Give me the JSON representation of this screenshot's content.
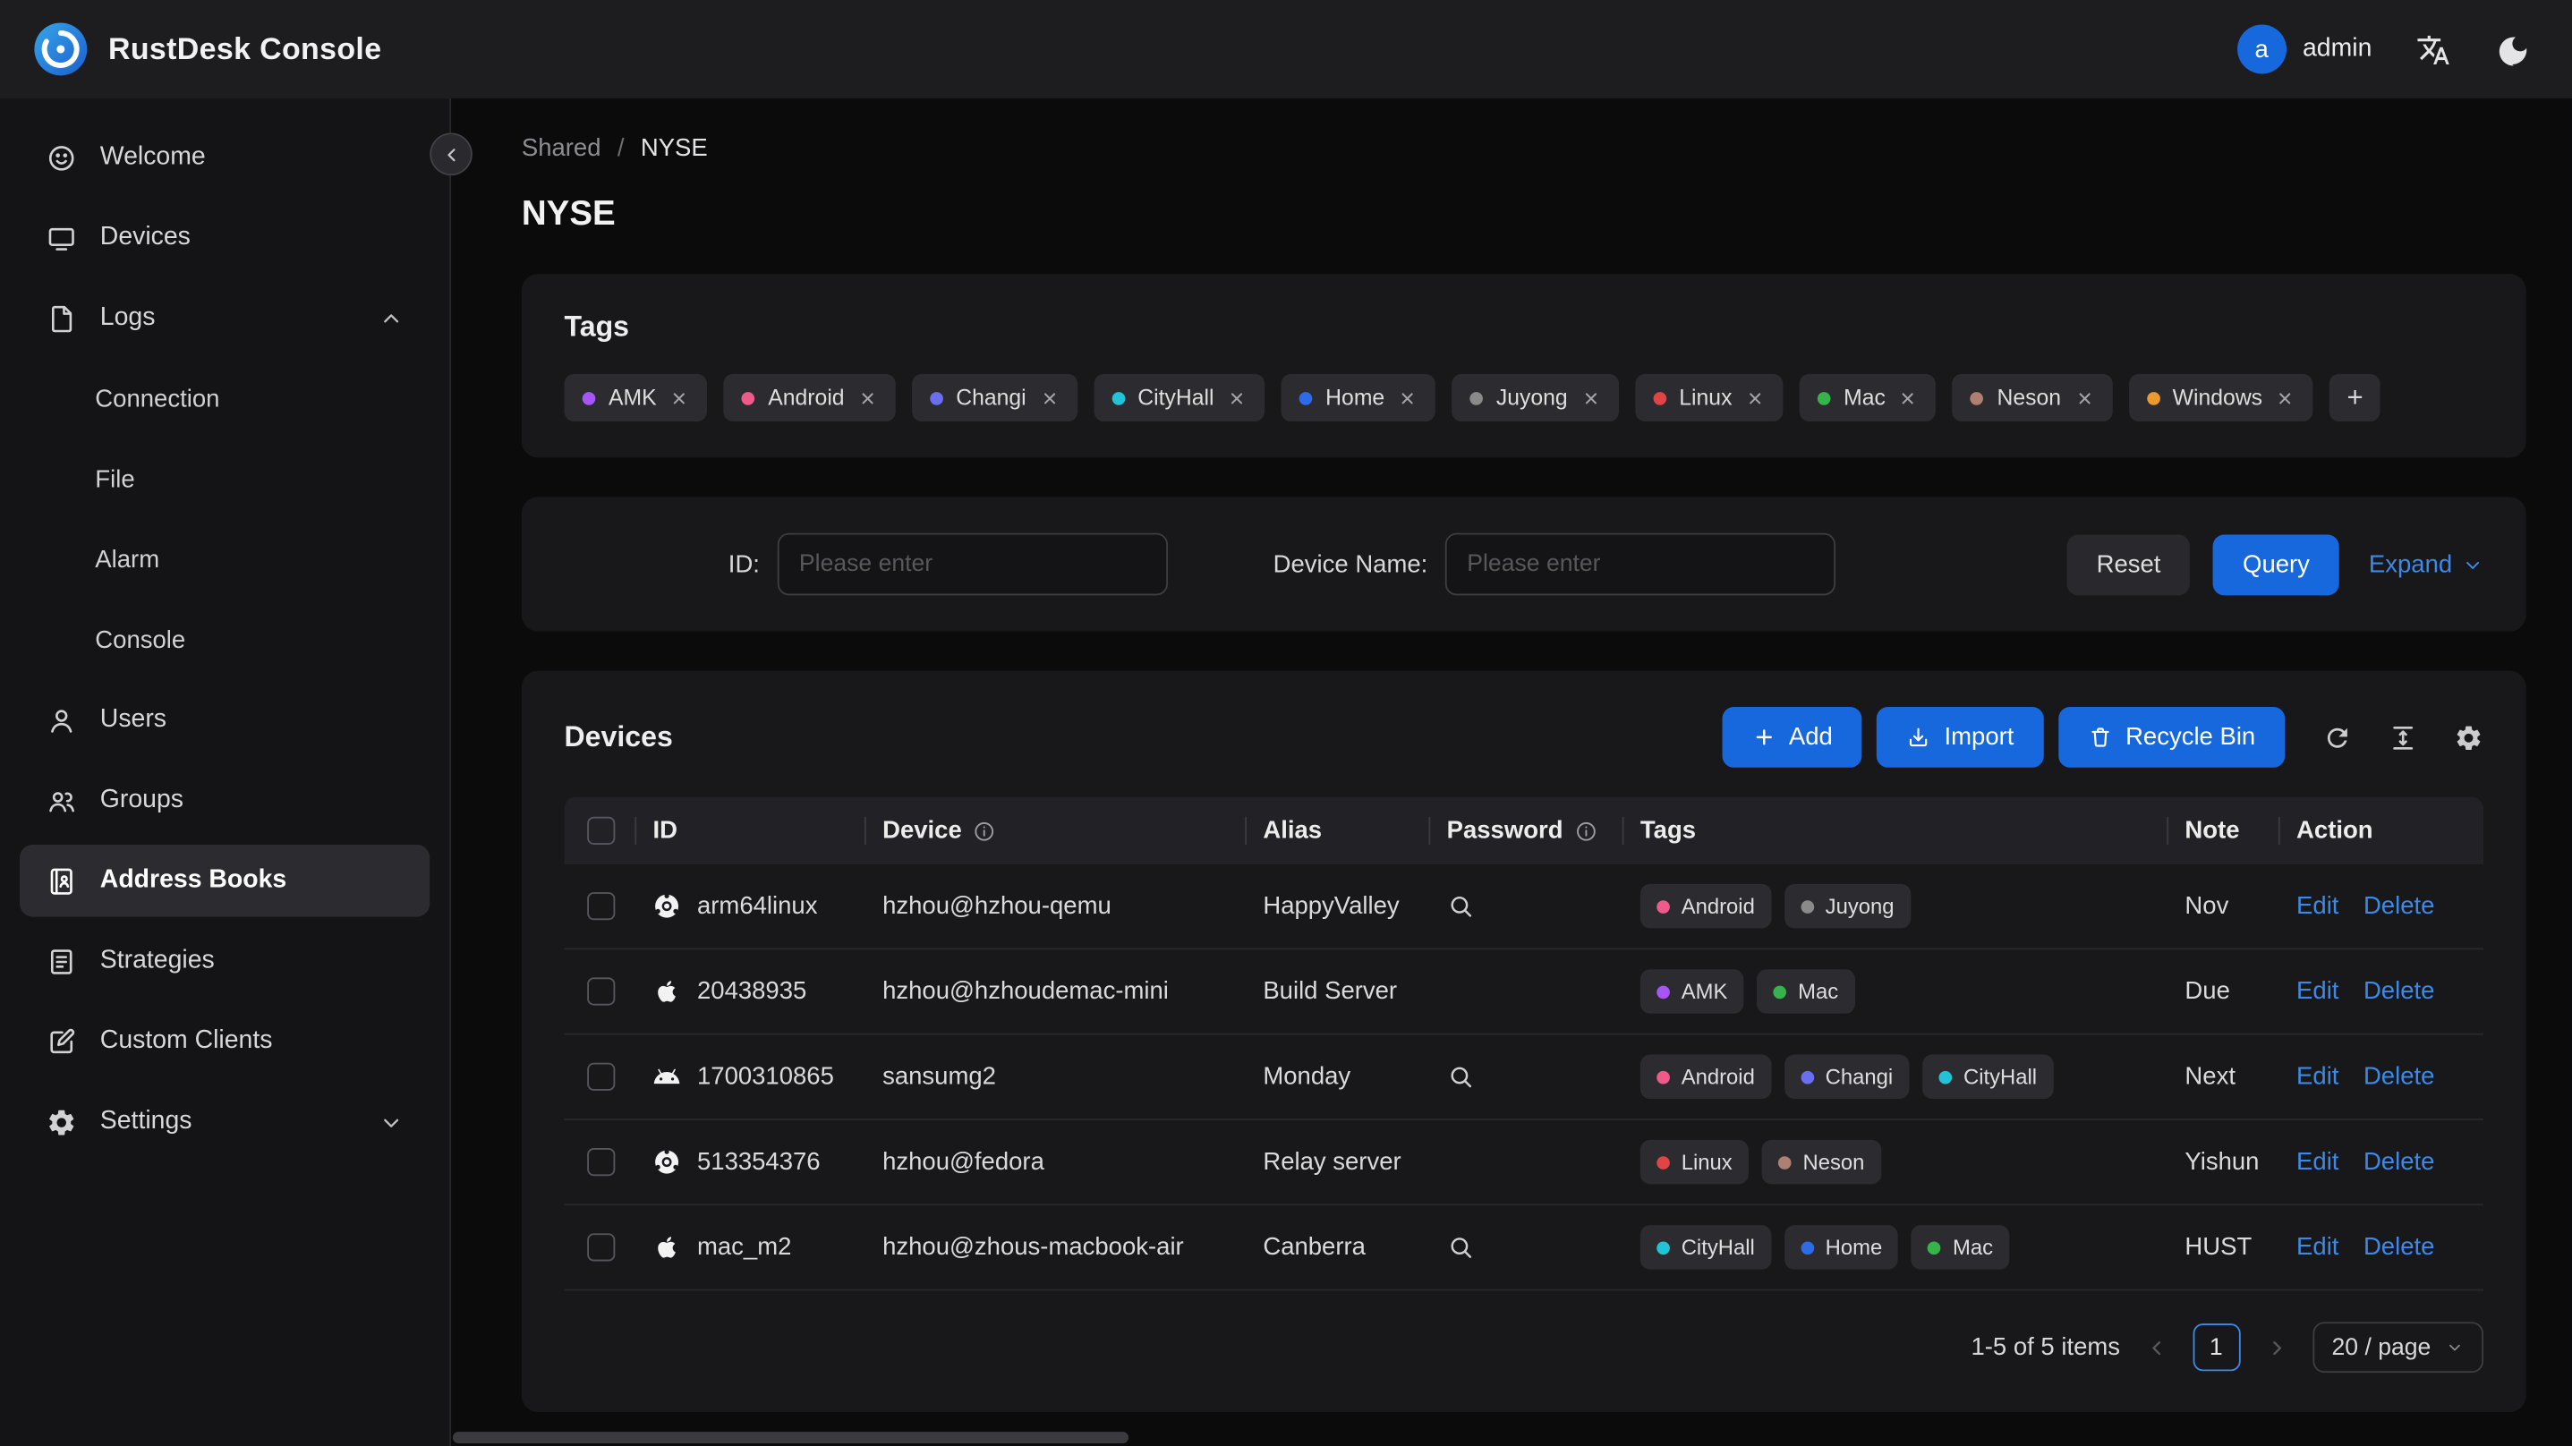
{
  "colors": {
    "accent": "#1668dc",
    "link": "#3c89e8",
    "avatar_bg": "#1668dc",
    "tag_colors": {
      "AMK": "#a855f7",
      "Android": "#ee5b8a",
      "Changi": "#6a6ff0",
      "CityHall": "#22c3d6",
      "Home": "#2e6be6",
      "Juyong": "#8a8a8a",
      "Linux": "#e04444",
      "Mac": "#36b34a",
      "Neson": "#ad8071",
      "Windows": "#eb9a2d"
    }
  },
  "header": {
    "app_title": "RustDesk Console",
    "user_initial": "a",
    "user_name": "admin"
  },
  "icon_glyphs": {
    "translate-icon": "language/translate",
    "moon-icon": "dark-mode crescent",
    "refresh-icon": "reload circular arrow",
    "column-height-icon": "row density arrows",
    "table-settings-icon": "gear",
    "search-icon": "magnifier",
    "info-icon": "circled i",
    "close-icon": "x",
    "plus-icon": "+",
    "import-icon": "tray with arrow",
    "trash-icon": "trash can",
    "chevron-left-icon": "<",
    "chevron-right-icon": ">",
    "chevron-up-icon": "^",
    "chevron-down-icon": "v",
    "ubuntu-icon": "ubuntu circle logo",
    "apple-icon": "apple logo",
    "android-icon": "android robot head"
  },
  "sidebar": {
    "items": [
      {
        "label": "Welcome",
        "icon": "smile-icon"
      },
      {
        "label": "Devices",
        "icon": "monitor-icon"
      },
      {
        "label": "Logs",
        "icon": "file-icon",
        "chevron": "up",
        "children": [
          "Connection",
          "File",
          "Alarm",
          "Console"
        ]
      },
      {
        "label": "Users",
        "icon": "user-icon"
      },
      {
        "label": "Groups",
        "icon": "group-icon"
      },
      {
        "label": "Address Books",
        "icon": "address-book-icon",
        "active": true
      },
      {
        "label": "Strategies",
        "icon": "strategy-icon"
      },
      {
        "label": "Custom Clients",
        "icon": "custom-client-icon"
      },
      {
        "label": "Settings",
        "icon": "gear-icon",
        "chevron": "down"
      }
    ]
  },
  "breadcrumb": {
    "parent": "Shared",
    "separator": "/",
    "current": "NYSE"
  },
  "page": {
    "title": "NYSE"
  },
  "tags_card": {
    "title": "Tags",
    "tags": [
      "AMK",
      "Android",
      "Changi",
      "CityHall",
      "Home",
      "Juyong",
      "Linux",
      "Mac",
      "Neson",
      "Windows"
    ],
    "add_button": "+"
  },
  "filter_card": {
    "id_label": "ID:",
    "id_placeholder": "Please enter",
    "id_value": "",
    "device_name_label": "Device Name:",
    "device_name_placeholder": "Please enter",
    "device_name_value": "",
    "reset_button": "Reset",
    "query_button": "Query",
    "expand_link": "Expand"
  },
  "devices_card": {
    "title": "Devices",
    "add_button": "Add",
    "import_button": "Import",
    "recycle_bin_button": "Recycle Bin",
    "columns": [
      {
        "label": "ID"
      },
      {
        "label": "Device",
        "info": true
      },
      {
        "label": "Alias"
      },
      {
        "label": "Password",
        "info": true
      },
      {
        "label": "Tags"
      },
      {
        "label": "Note"
      },
      {
        "label": "Action"
      }
    ],
    "rows": [
      {
        "os": "ubuntu",
        "id": "arm64linux",
        "device": "hzhou@hzhou-qemu",
        "alias": "HappyValley",
        "password_search": true,
        "tags": [
          "Android",
          "Juyong"
        ],
        "note": "Nov"
      },
      {
        "os": "apple",
        "id": "20438935",
        "device": "hzhou@hzhoudemac-mini",
        "alias": "Build Server",
        "password_search": false,
        "tags": [
          "AMK",
          "Mac"
        ],
        "note": "Due"
      },
      {
        "os": "android",
        "id": "1700310865",
        "device": "sansumg2",
        "alias": "Monday",
        "password_search": true,
        "tags": [
          "Android",
          "Changi",
          "CityHall"
        ],
        "note": "Next"
      },
      {
        "os": "ubuntu",
        "id": "513354376",
        "device": "hzhou@fedora",
        "alias": "Relay server",
        "password_search": false,
        "tags": [
          "Linux",
          "Neson"
        ],
        "note": "Yishun"
      },
      {
        "os": "apple",
        "id": "mac_m2",
        "device": "hzhou@zhous-macbook-air",
        "alias": "Canberra",
        "password_search": true,
        "tags": [
          "CityHall",
          "Home",
          "Mac"
        ],
        "note": "HUST"
      }
    ],
    "row_actions": {
      "edit": "Edit",
      "delete": "Delete"
    },
    "pagination": {
      "summary": "1-5 of 5 items",
      "current_page": "1",
      "page_size": "20 / page"
    }
  }
}
